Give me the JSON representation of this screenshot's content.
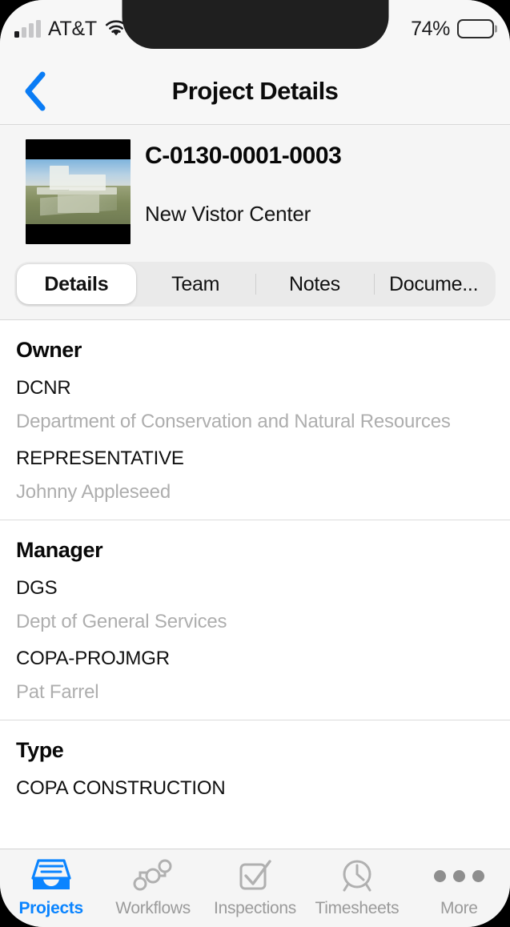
{
  "status_bar": {
    "carrier": "AT&T",
    "battery_percent": "74%",
    "battery_level": 74,
    "signal_bars_filled": 1,
    "signal_bars_total": 4,
    "wifi_icon": "wifi-icon"
  },
  "nav": {
    "back_icon": "back-chevron-icon",
    "title": "Project Details"
  },
  "project": {
    "thumbnail_alt": "project-thumbnail",
    "id": "C-0130-0001-0003",
    "name": "New Vistor Center"
  },
  "tabs": {
    "selected": "Details",
    "items": [
      {
        "label": "Details",
        "selected": true
      },
      {
        "label": "Team",
        "selected": false
      },
      {
        "label": "Notes",
        "selected": false
      },
      {
        "label": "Docume...",
        "selected": false
      }
    ]
  },
  "sections": [
    {
      "title": "Owner",
      "fields": [
        {
          "label": "DCNR",
          "value": "Department of Conservation and Natural Resources"
        },
        {
          "label": "REPRESENTATIVE",
          "value": "Johnny Appleseed"
        }
      ]
    },
    {
      "title": "Manager",
      "fields": [
        {
          "label": "DGS",
          "value": "Dept of General Services"
        },
        {
          "label": "COPA-PROJMGR",
          "value": "Pat Farrel"
        }
      ]
    },
    {
      "title": "Type",
      "fields": [
        {
          "label": "COPA CONSTRUCTION",
          "value": ""
        }
      ]
    }
  ],
  "tabbar": {
    "items": [
      {
        "label": "Projects",
        "icon": "file-tray-icon",
        "active": true
      },
      {
        "label": "Workflows",
        "icon": "flowchart-icon",
        "active": false
      },
      {
        "label": "Inspections",
        "icon": "checkbox-check-icon",
        "active": false
      },
      {
        "label": "Timesheets",
        "icon": "clock-icon",
        "active": false
      },
      {
        "label": "More",
        "icon": "ellipsis-icon",
        "active": false
      }
    ]
  },
  "colors": {
    "accent": "#0a84ff",
    "secondary_text": "#aeaeae",
    "header_bg": "#f5f5f5"
  }
}
